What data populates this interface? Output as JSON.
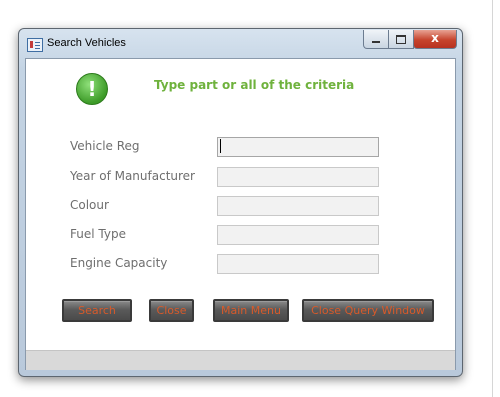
{
  "window": {
    "title": "Search Vehicles",
    "close_symbol": "x"
  },
  "header": {
    "icon": "exclamation-icon",
    "message": "Type part or all of the criteria"
  },
  "form": {
    "fields": [
      {
        "label": "Vehicle Reg",
        "value": "",
        "focused": true
      },
      {
        "label": "Year of Manufacturer",
        "value": ""
      },
      {
        "label": "Colour",
        "value": ""
      },
      {
        "label": "Fuel Type",
        "value": ""
      },
      {
        "label": "Engine Capacity",
        "value": ""
      }
    ]
  },
  "buttons": {
    "search": "Search",
    "close": "Close",
    "main_menu": "Main Menu",
    "close_query_window": "Close Query Window"
  },
  "colors": {
    "heading_text": "#6fb23d",
    "button_text": "#d85a2a",
    "icon_green": "#3d9b28"
  }
}
